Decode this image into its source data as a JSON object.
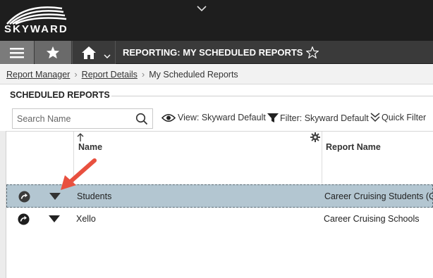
{
  "app": {
    "logo_text": "SKYWARD",
    "page_title": "REPORTING: MY SCHEDULED REPORTS"
  },
  "breadcrumb": {
    "items": [
      "Report Manager",
      "Report Details",
      "My Scheduled Reports"
    ]
  },
  "section": {
    "title": "SCHEDULED REPORTS"
  },
  "search": {
    "placeholder": "Search Name"
  },
  "toolbar": {
    "view_label": "View: Skyward Default",
    "filter_label": "Filter: Skyward Default",
    "quick_filter_label": "Quick Filter"
  },
  "table": {
    "columns": [
      "Name",
      "Report Name"
    ],
    "rows": [
      {
        "name": "Students",
        "report_name": "Career Cruising Students (Clo",
        "selected": true
      },
      {
        "name": "Xello",
        "report_name": "Career Cruising Schools",
        "selected": false
      }
    ]
  },
  "colors": {
    "topbar": "#1e1e1e",
    "navbar": "#3a3a3a",
    "selected_row": "#b3c6d1",
    "annotation_arrow": "#e8503f"
  },
  "icons": [
    "hamburger-menu-icon",
    "star-icon",
    "home-icon",
    "chevron-down-icon",
    "search-icon",
    "eye-icon",
    "filter-icon",
    "quick-filter-chevrons-icon",
    "gear-icon",
    "run-report-icon",
    "triangle-down-icon"
  ]
}
